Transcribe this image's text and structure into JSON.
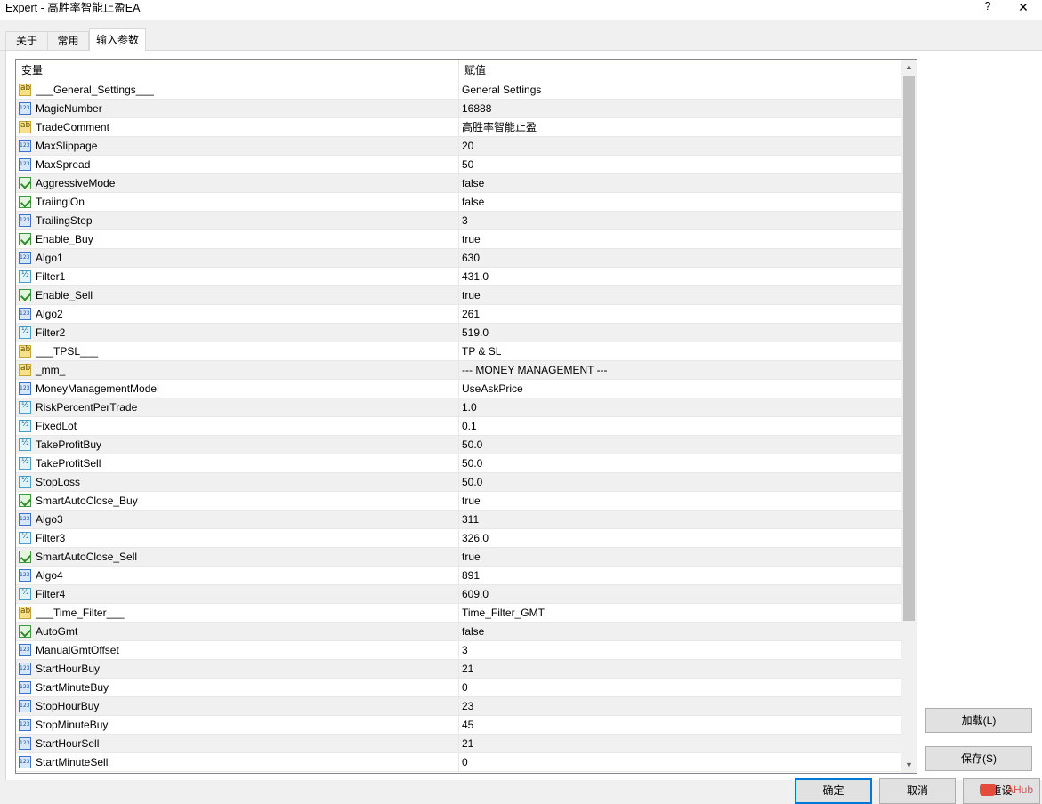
{
  "window": {
    "title": "Expert - 高胜率智能止盈EA",
    "help_glyph": "?",
    "close_glyph": "✕"
  },
  "tabs": [
    {
      "label": "关于",
      "active": false
    },
    {
      "label": "常用",
      "active": false
    },
    {
      "label": "输入参数",
      "active": true
    }
  ],
  "grid": {
    "headers": {
      "variable": "变量",
      "value": "赋值"
    },
    "rows": [
      {
        "type": "string",
        "icon": "string-icon",
        "name": "___General_Settings___",
        "value": "General Settings"
      },
      {
        "type": "int",
        "icon": "integer-icon",
        "name": "MagicNumber",
        "value": "16888"
      },
      {
        "type": "string",
        "icon": "string-icon",
        "name": "TradeComment",
        "value": "高胜率智能止盈"
      },
      {
        "type": "int",
        "icon": "integer-icon",
        "name": "MaxSlippage",
        "value": "20"
      },
      {
        "type": "int",
        "icon": "integer-icon",
        "name": "MaxSpread",
        "value": "50"
      },
      {
        "type": "bool",
        "icon": "boolean-icon",
        "name": "AggressiveMode",
        "value": "false"
      },
      {
        "type": "bool",
        "icon": "boolean-icon",
        "name": "TraiinglOn",
        "value": "false"
      },
      {
        "type": "int",
        "icon": "integer-icon",
        "name": "TrailingStep",
        "value": "3"
      },
      {
        "type": "bool",
        "icon": "boolean-icon",
        "name": "Enable_Buy",
        "value": "true"
      },
      {
        "type": "int",
        "icon": "integer-icon",
        "name": "Algo1",
        "value": "630"
      },
      {
        "type": "double",
        "icon": "double-icon",
        "name": "Filter1",
        "value": "431.0"
      },
      {
        "type": "bool",
        "icon": "boolean-icon",
        "name": "Enable_Sell",
        "value": "true"
      },
      {
        "type": "int",
        "icon": "integer-icon",
        "name": "Algo2",
        "value": "261"
      },
      {
        "type": "double",
        "icon": "double-icon",
        "name": "Filter2",
        "value": "519.0"
      },
      {
        "type": "string",
        "icon": "string-icon",
        "name": "___TPSL___",
        "value": "TP & SL"
      },
      {
        "type": "string",
        "icon": "string-icon",
        "name": "_mm_",
        "value": "--- MONEY MANAGEMENT ---"
      },
      {
        "type": "int",
        "icon": "integer-icon",
        "name": "MoneyManagementModel",
        "value": "UseAskPrice"
      },
      {
        "type": "double",
        "icon": "double-icon",
        "name": "RiskPercentPerTrade",
        "value": "1.0"
      },
      {
        "type": "double",
        "icon": "double-icon",
        "name": "FixedLot",
        "value": "0.1"
      },
      {
        "type": "double",
        "icon": "double-icon",
        "name": "TakeProfitBuy",
        "value": "50.0"
      },
      {
        "type": "double",
        "icon": "double-icon",
        "name": "TakeProfitSell",
        "value": "50.0"
      },
      {
        "type": "double",
        "icon": "double-icon",
        "name": "StopLoss",
        "value": "50.0"
      },
      {
        "type": "bool",
        "icon": "boolean-icon",
        "name": "SmartAutoClose_Buy",
        "value": "true"
      },
      {
        "type": "int",
        "icon": "integer-icon",
        "name": "Algo3",
        "value": "311"
      },
      {
        "type": "double",
        "icon": "double-icon",
        "name": "Filter3",
        "value": "326.0"
      },
      {
        "type": "bool",
        "icon": "boolean-icon",
        "name": "SmartAutoClose_Sell",
        "value": "true"
      },
      {
        "type": "int",
        "icon": "integer-icon",
        "name": "Algo4",
        "value": "891"
      },
      {
        "type": "double",
        "icon": "double-icon",
        "name": "Filter4",
        "value": "609.0"
      },
      {
        "type": "string",
        "icon": "string-icon",
        "name": "___Time_Filter___",
        "value": "Time_Filter_GMT"
      },
      {
        "type": "bool",
        "icon": "boolean-icon",
        "name": "AutoGmt",
        "value": "false"
      },
      {
        "type": "int",
        "icon": "integer-icon",
        "name": "ManualGmtOffset",
        "value": "3"
      },
      {
        "type": "int",
        "icon": "integer-icon",
        "name": "StartHourBuy",
        "value": "21"
      },
      {
        "type": "int",
        "icon": "integer-icon",
        "name": "StartMinuteBuy",
        "value": "0"
      },
      {
        "type": "int",
        "icon": "integer-icon",
        "name": "StopHourBuy",
        "value": "23"
      },
      {
        "type": "int",
        "icon": "integer-icon",
        "name": "StopMinuteBuy",
        "value": "45"
      },
      {
        "type": "int",
        "icon": "integer-icon",
        "name": "StartHourSell",
        "value": "21"
      },
      {
        "type": "int",
        "icon": "integer-icon",
        "name": "StartMinuteSell",
        "value": "0"
      }
    ],
    "scroll_up_glyph": "▲",
    "scroll_down_glyph": "▼"
  },
  "buttons": {
    "load": "加载(L)",
    "save": "保存(S)",
    "ok": "确定",
    "cancel": "取消",
    "reset": "重设"
  },
  "watermark": {
    "text": "AHub"
  },
  "colors": {
    "accent": "#0078d7",
    "row_alt": "#f0f0f0",
    "panel_bg": "#ffffff",
    "dialog_bg": "#f0f0f0"
  }
}
